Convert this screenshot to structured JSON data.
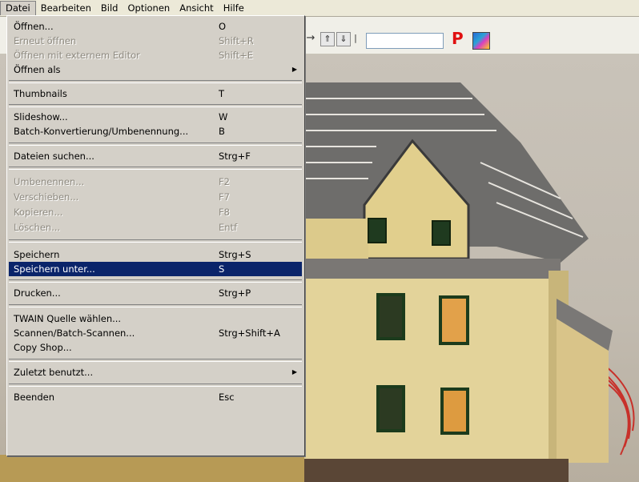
{
  "menubar": {
    "items": [
      {
        "label": "Datei",
        "active": true
      },
      {
        "label": "Bearbeiten"
      },
      {
        "label": "Bild"
      },
      {
        "label": "Optionen"
      },
      {
        "label": "Ansicht"
      },
      {
        "label": "Hilfe"
      }
    ]
  },
  "toolbar": {
    "p_label": "P",
    "icons": [
      "arrow-right-icon",
      "up-arrow-button-icon",
      "down-arrow-button-icon",
      "image-color-icon"
    ]
  },
  "file_menu": {
    "items": [
      {
        "label": "Öffnen...",
        "shortcut": "O"
      },
      {
        "label": "Erneut öffnen",
        "shortcut": "Shift+R",
        "disabled": true
      },
      {
        "label": "Öffnen mit externem Editor",
        "shortcut": "Shift+E",
        "disabled": true
      },
      {
        "label": "Öffnen als",
        "submenu": true
      },
      {
        "label": "Thumbnails",
        "shortcut": "T"
      },
      {
        "label": "Slideshow...",
        "shortcut": "W"
      },
      {
        "label": "Batch-Konvertierung/Umbenennung...",
        "shortcut": "B"
      },
      {
        "label": "Dateien suchen...",
        "shortcut": "Strg+F"
      },
      {
        "label": "Umbenennen...",
        "shortcut": "F2",
        "disabled": true
      },
      {
        "label": "Verschieben...",
        "shortcut": "F7",
        "disabled": true
      },
      {
        "label": "Kopieren...",
        "shortcut": "F8",
        "disabled": true
      },
      {
        "label": "Löschen...",
        "shortcut": "Entf",
        "disabled": true
      },
      {
        "label": "Speichern",
        "shortcut": "Strg+S"
      },
      {
        "label": "Speichern unter...",
        "shortcut": "S",
        "selected": true
      },
      {
        "label": "Drucken...",
        "shortcut": "Strg+P"
      },
      {
        "label": "TWAIN Quelle wählen..."
      },
      {
        "label": "Scannen/Batch-Scannen...",
        "shortcut": "Strg+Shift+A"
      },
      {
        "label": "Copy Shop..."
      },
      {
        "label": "Zuletzt benutzt...",
        "submenu": true
      },
      {
        "label": "Beenden",
        "shortcut": "Esc"
      }
    ]
  },
  "colors": {
    "menu_bg": "#d4d0c8",
    "selection": "#0a246a",
    "disabled_text": "#8e8a80",
    "house_wall": "#e3d39a",
    "roof": "#6d6c6a"
  }
}
